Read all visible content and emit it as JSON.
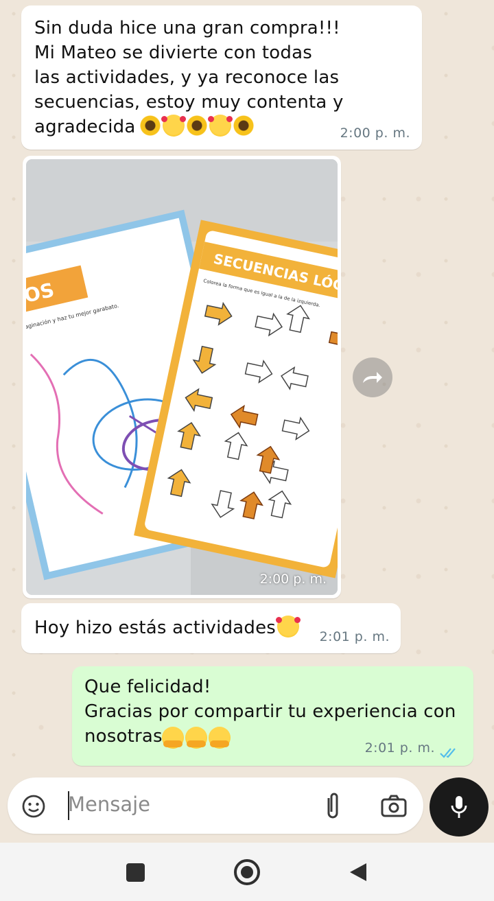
{
  "messages": [
    {
      "direction": "incoming",
      "text": "Sin duda hice una gran compra!!!\nMi Mateo se divierte con todas\nlas actividades, y ya reconoce las\nsecuencias, estoy muy contenta y\nagradecida",
      "emojis": [
        "sunflower",
        "smiling-face-with-hearts",
        "sunflower",
        "smiling-face-with-hearts",
        "sunflower"
      ],
      "time": "2:00 p. m."
    },
    {
      "direction": "incoming",
      "type": "photo",
      "time": "2:00 p. m.",
      "photo_text": {
        "left_sheet_title": "AZOS",
        "left_sheet_subtitle": "cata tu imaginación y haz tu mejor garabato.",
        "right_sheet_title": "SECUENCIAS LÓGIC",
        "right_sheet_instruction": "Colorea la forma que es igual a la de la izquierda."
      }
    },
    {
      "direction": "incoming",
      "text": "Hoy hizo estás actividades",
      "emojis": [
        "smiling-face-with-hearts"
      ],
      "time": "2:01 p. m."
    },
    {
      "direction": "outgoing",
      "text": "Que felicidad!\nGracias por compartir tu experiencia con\nnosotras",
      "emojis": [
        "hugging-face",
        "hugging-face",
        "hugging-face"
      ],
      "time": "2:01 p. m.",
      "status": "read-double-check"
    }
  ],
  "input": {
    "placeholder": "Mensaje",
    "icons": [
      "sticker-icon",
      "attach-icon",
      "camera-icon",
      "mic-icon"
    ]
  },
  "forward_icon": "forward-icon",
  "navbar": {
    "icons": [
      "recents-square-icon",
      "home-circle-icon",
      "back-triangle-icon"
    ]
  },
  "colors": {
    "incoming_bubble": "#ffffff",
    "outgoing_bubble": "#d9fdd3",
    "timestamp": "#667781",
    "read_check": "#53bdeb",
    "wallpaper": "#efe6da"
  }
}
